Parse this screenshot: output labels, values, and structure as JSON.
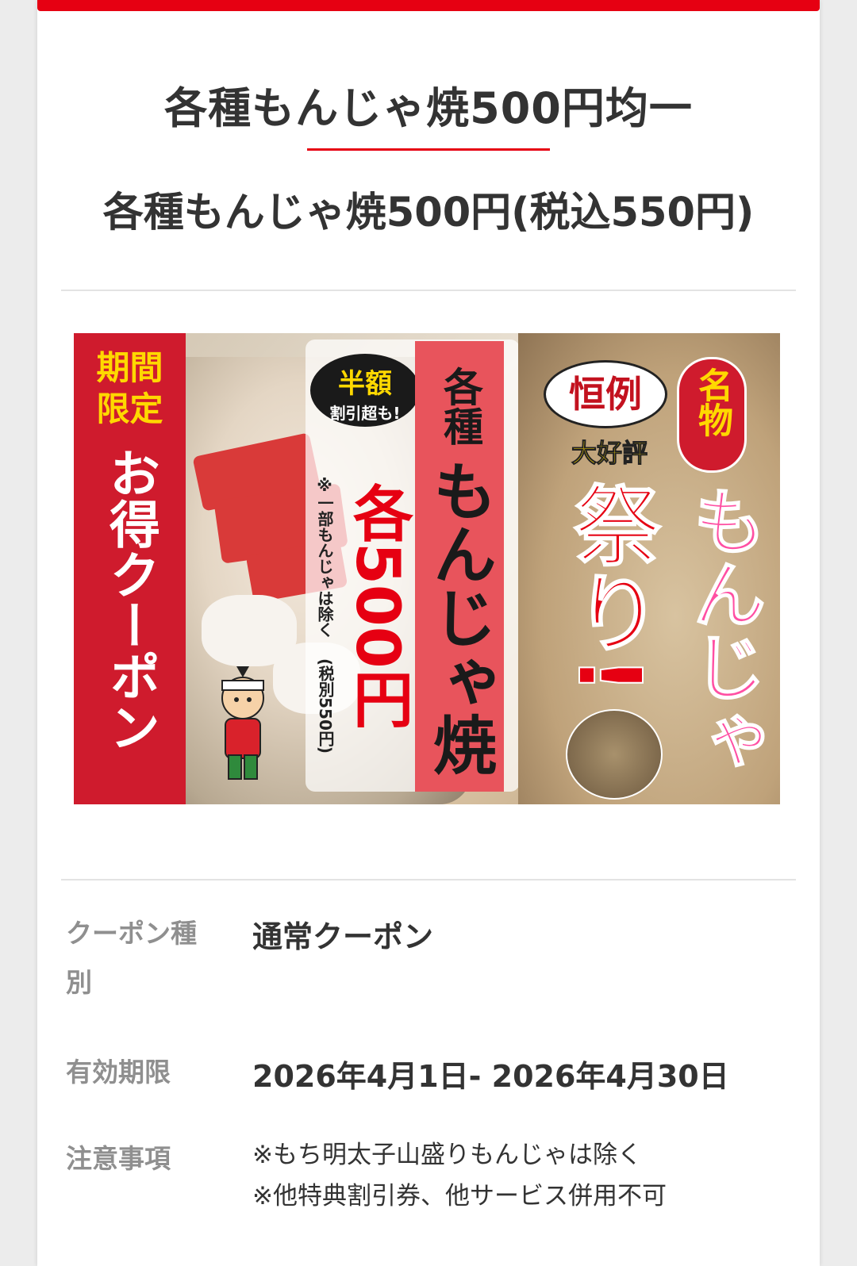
{
  "header": {
    "title": "各種もんじゃ焼500円均一",
    "subtitle": "各種もんじゃ焼500円(税込550円)"
  },
  "banner": {
    "left_top_line1": "期間",
    "left_top_line2": "限定",
    "left_main": "お得クーポン",
    "bubble_line1": "半額",
    "bubble_line2": "割引超も!",
    "kind": "各種",
    "dish": "もんじゃ焼",
    "price": "各500円",
    "note_excl": "※一部もんじゃは除く",
    "note_tax": "(税別550円)",
    "kourei": "恒例",
    "meibutsu": "名物",
    "daikohyo": "大好評",
    "matsuri": "祭り!",
    "monja": "もんじゃ"
  },
  "details": {
    "type_label": "クーポン種別",
    "type_value": "通常クーポン",
    "period_label": "有効期限",
    "period_value": "2026年4月1日- 2026年4月30日",
    "notes_label": "注意事項",
    "notes": [
      "※もち明太子山盛りもんじゃは除く",
      "※他特典割引券、他サービス併用不可"
    ]
  },
  "colors": {
    "accent": "#e60012",
    "text": "#333333",
    "label": "#8f8f8f"
  }
}
